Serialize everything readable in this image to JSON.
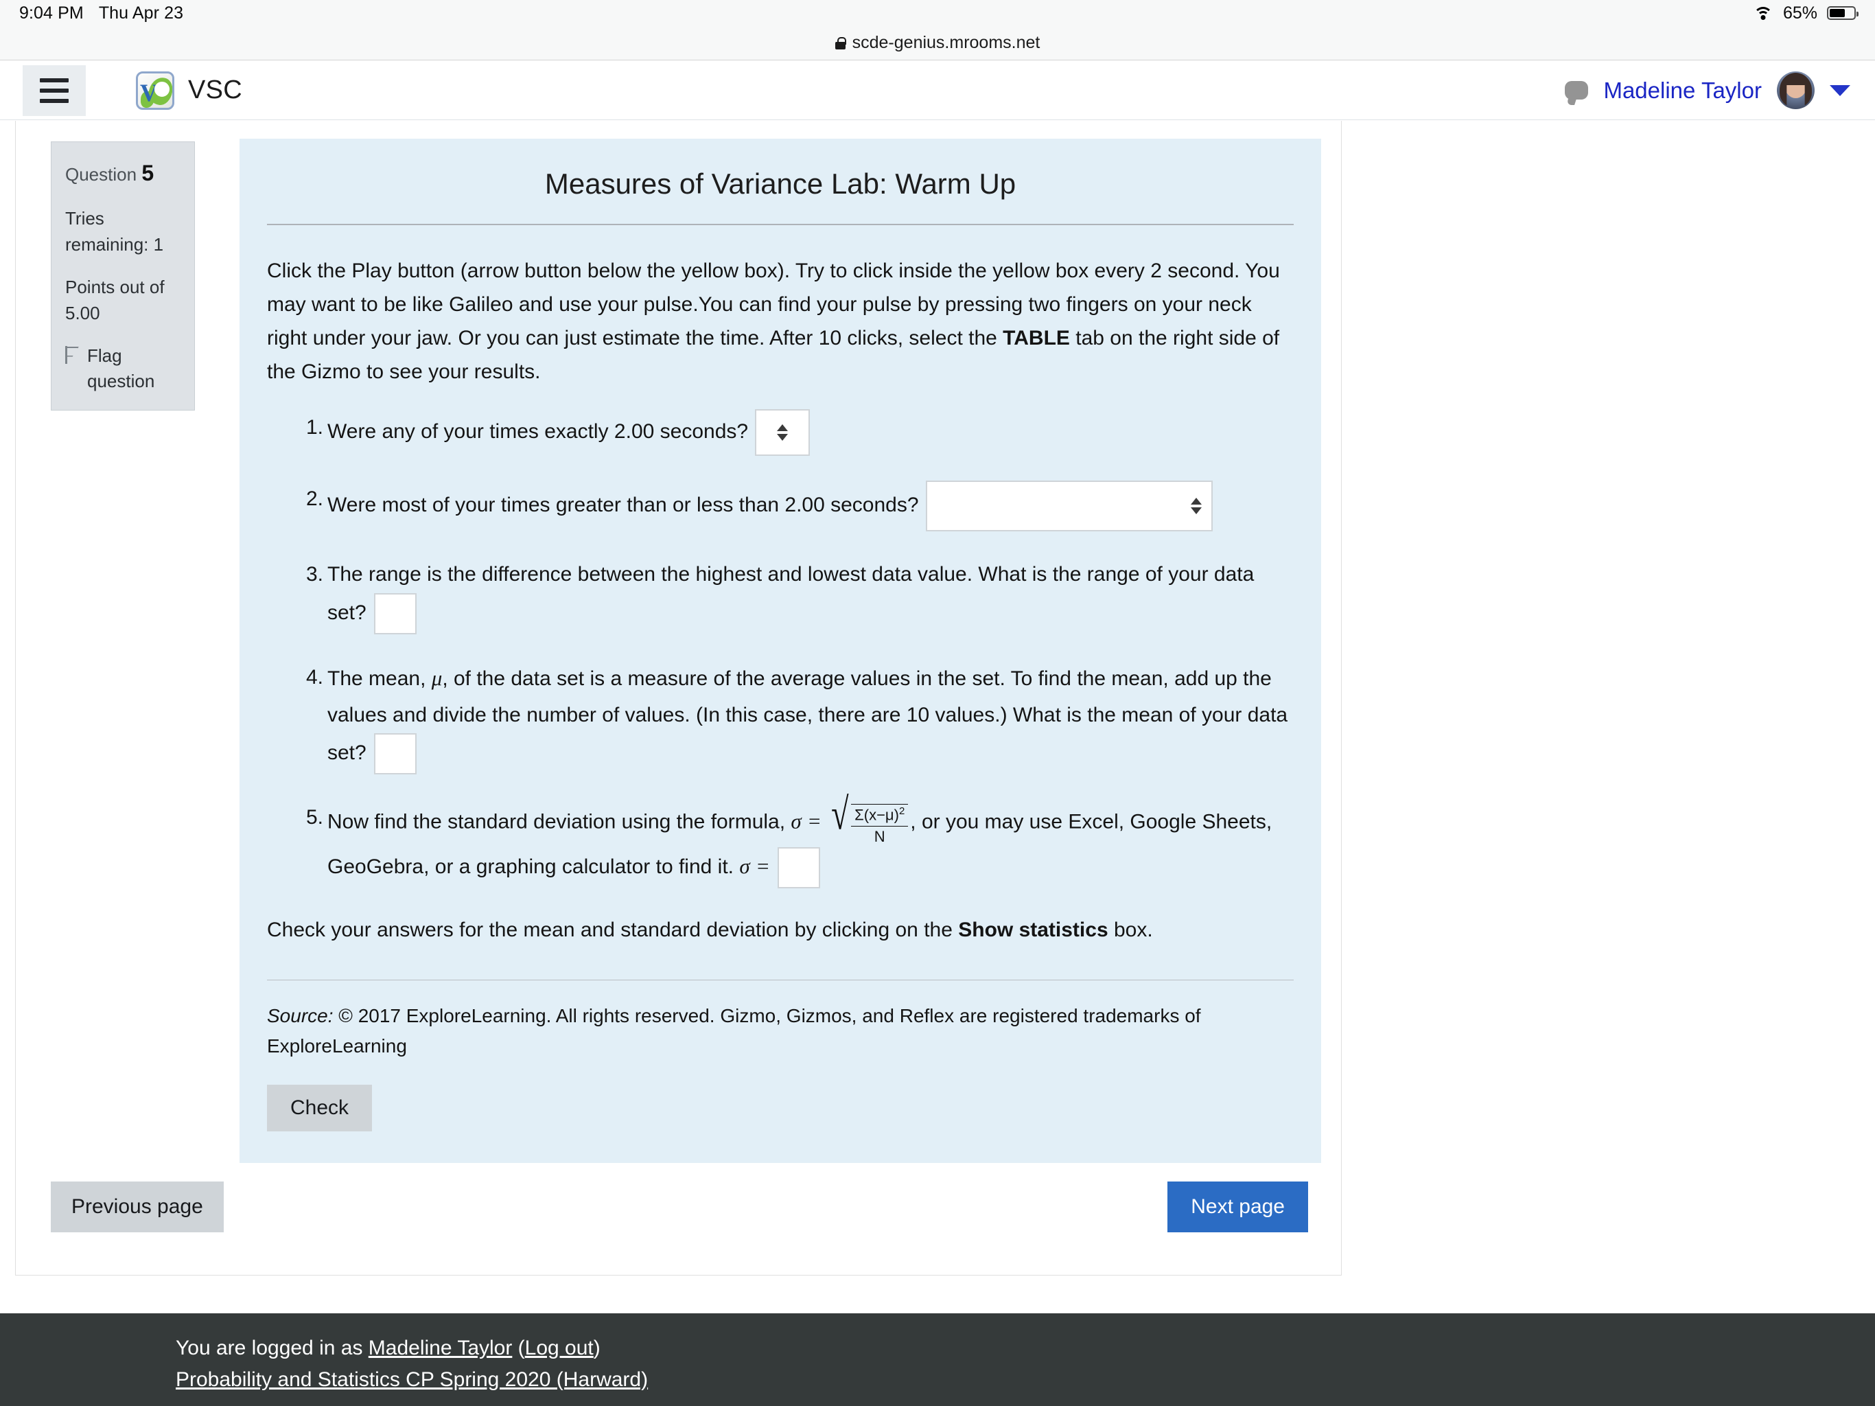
{
  "statusbar": {
    "time": "9:04 PM",
    "date": "Thu Apr 23",
    "battery_percent": "65%",
    "wifi_icon": "wifi-icon",
    "battery_icon": "battery-icon"
  },
  "browser": {
    "lock_icon": "lock-icon",
    "url": "scde-genius.mrooms.net"
  },
  "header": {
    "menu_icon": "hamburger-menu-icon",
    "logo_icon": "vsc-logo-icon",
    "brand_name": "VSC",
    "message_icon": "message-bubble-icon",
    "user_name": "Madeline Taylor",
    "avatar_icon": "user-avatar",
    "caret_icon": "chevron-down-icon"
  },
  "question_info": {
    "question_label": "Question",
    "question_number": "5",
    "tries_label": "Tries remaining: 1",
    "points_label": "Points out of 5.00",
    "flag_icon": "flag-icon",
    "flag_label": "Flag question"
  },
  "question": {
    "title": "Measures of Variance Lab: Warm Up",
    "intro_part1": "Click the Play button (arrow button below the yellow box). Try to click inside the yellow box every 2 second. You may want to be like Galileo and use your pulse.You can find your pulse by pressing two fingers on your neck right under your jaw. Or you can just estimate the time. After 10 clicks, select the ",
    "intro_bold": "TABLE",
    "intro_part2": " tab on the right side of the Gizmo to see your results.",
    "items": [
      {
        "text": "Were any of your times exactly 2.00 seconds?",
        "control": "select",
        "value": ""
      },
      {
        "text": "Were most of your times greater than or less than 2.00 seconds?",
        "control": "select",
        "value": ""
      },
      {
        "text": "The range is the difference between the highest and lowest data value. What is the range of your data set?",
        "control": "input",
        "value": ""
      },
      {
        "text_part1": "The mean, ",
        "symbol": "μ",
        "text_part2": ", of the data set is a measure of the average values in the set. To find the mean, add up the values and divide the number of values. (In this case, there are 10 values.) What is the mean of your data set?",
        "control": "input",
        "value": ""
      },
      {
        "text_part1": "Now find the standard deviation using the formula, ",
        "sigma": "σ",
        "equals": "=",
        "formula_numerator": "Σ(x−μ)",
        "formula_exponent": "2",
        "formula_denominator": "N",
        "text_part2": ", or you may use Excel, Google Sheets, GeoGebra, or a graphing calculator to find it. ",
        "control": "input",
        "value": ""
      }
    ],
    "check_text_part1": "Check your answers for the mean and standard deviation by clicking on the ",
    "check_text_bold": "Show statistics",
    "check_text_part2": " box.",
    "source_italic": "Source:",
    "source_text": " © 2017 ExploreLearning.  All rights reserved.  Gizmo, Gizmos, and Reflex are registered trademarks of ExploreLearning",
    "check_button": "Check"
  },
  "navigation": {
    "previous_page": "Previous page",
    "next_page": "Next page"
  },
  "footer": {
    "logged_in_prefix": "You are logged in as ",
    "logged_in_user": "Madeline Taylor",
    "paren_open": " (",
    "logout": "Log out",
    "paren_close": ")",
    "course": "Probability and Statistics CP Spring 2020 (Harward)"
  },
  "colors": {
    "accent_blue": "#2b6cc4",
    "link_blue": "#1a25c4",
    "question_bg": "#e2eff7",
    "info_box_bg": "#dee2e6",
    "footer_bg": "#353a3a"
  }
}
